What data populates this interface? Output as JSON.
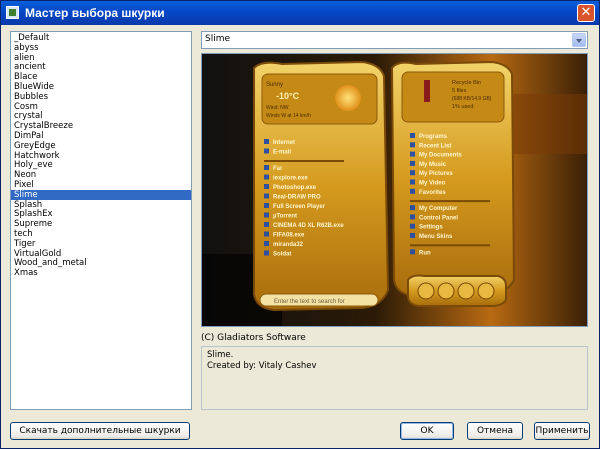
{
  "window": {
    "title": "Мастер выбора шкурки"
  },
  "skins": {
    "items": [
      "_Default",
      "abyss",
      "alien",
      "ancient",
      "Blace",
      "BlueWide",
      "Bubbles",
      "Cosm",
      "crystal",
      "CrystalBreeze",
      "DimPal",
      "GreyEdge",
      "Hatchwork",
      "Holy_eve",
      "Neon",
      "Pixel",
      "Slime",
      "Splash",
      "SplashEx",
      "Supreme",
      "tech",
      "Tiger",
      "VirtualGold",
      "Wood_and_metal",
      "Xmas"
    ],
    "selected": "Slime"
  },
  "combo": {
    "value": "Slime"
  },
  "preview": {
    "weather": {
      "city": "Sunny",
      "temp": "-10°C",
      "line1": "Wind: NW",
      "line2": "Winds W at 14 km/h"
    },
    "recycle": {
      "title": "Recycle Bin",
      "files": "5 files",
      "size": "(688 KB/14.9 GB)",
      "used": "1% used"
    },
    "left_items": [
      "Internet",
      "E-mail",
      "Far",
      "iexplore.exe",
      "Photoshop.exe",
      "Real-DRAW PRO",
      "Full Screen Player",
      "µTorrent",
      "CINEMA 4D XL R62B.exe",
      "FIFA08.exe",
      "miranda32",
      "Soldat"
    ],
    "right_items": [
      "Programs",
      "Recent List",
      "My Documents",
      "My Music",
      "My Pictures",
      "My Video",
      "Favorites",
      "My Computer",
      "Control Panel",
      "Settings",
      "Menu Skins",
      "Run"
    ],
    "search_placeholder": "Enter the text to search for"
  },
  "copyright": "(C) Gladiators Software",
  "description": {
    "line1": "Slime.",
    "line2": "Created by: Vitaly Cashev"
  },
  "buttons": {
    "download": "Скачать дополнительные шкурки",
    "ok": "OK",
    "cancel": "Отмена",
    "apply": "Применить"
  },
  "colors": {
    "selection": "#316ac5",
    "titlebar": "#0a5fd8",
    "slime": "#d9a521",
    "background": "#ece9d8"
  }
}
